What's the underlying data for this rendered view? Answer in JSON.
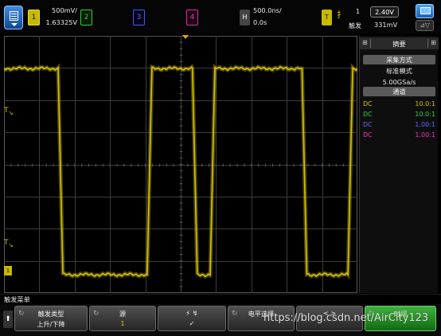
{
  "top_bar": {
    "ch1": {
      "number": "1",
      "scale": "500mV/",
      "offset": "1.63325V",
      "color": "#d8c400"
    },
    "ch2": {
      "number": "2",
      "color": "#2fd33a"
    },
    "ch3": {
      "number": "3",
      "color": "#5f6bff"
    },
    "ch4": {
      "number": "4",
      "color": "#f03ab1"
    },
    "horizontal": {
      "key": "H",
      "timebase": "500.0ns/",
      "delay": "0.0s"
    },
    "trigger": {
      "key": "T",
      "edge_glyph": "扌",
      "source": "1",
      "level": "2.40V",
      "label": "触发",
      "level2": "331mV"
    }
  },
  "panel": {
    "header": "摘要",
    "header_left": "⊞",
    "header_right": "⊞",
    "acq_label": "采集方式",
    "acq_mode": "标准模式",
    "sample_rate": "5.00GSa/s",
    "channels_label": "通道",
    "channel_rows": [
      {
        "coupling": "DC",
        "probe": "10.0:1",
        "color": "#d8c400"
      },
      {
        "coupling": "DC",
        "probe": "10.0:1",
        "color": "#2fd33a"
      },
      {
        "coupling": "DC",
        "probe": "1.00:1",
        "color": "#5f6bff"
      },
      {
        "coupling": "DC",
        "probe": "1.00:1",
        "color": "#f03ab1"
      }
    ]
  },
  "softkeys": {
    "menu_title": "触发菜单",
    "back_glyph": "⬆",
    "keys": [
      {
        "line1": "触发类型",
        "line2": "上升/下降"
      },
      {
        "line1": "源",
        "line2": "1"
      },
      {
        "line1": "⚡      ↯",
        "line2": "✓"
      },
      {
        "line1": "电平选择",
        "line2": ""
      },
      {
        "line1": "<        >",
        "line2": ""
      },
      {
        "line1": "时间",
        "line2": ""
      }
    ]
  },
  "watermark": "https://blog.csdn.net/AirCity123",
  "trace": {
    "color": "#d8c400",
    "high_level": "high",
    "low_level": "low",
    "transitions_div": [
      1.6,
      4.12,
      5.4,
      5.9,
      8.5,
      9.8
    ]
  }
}
